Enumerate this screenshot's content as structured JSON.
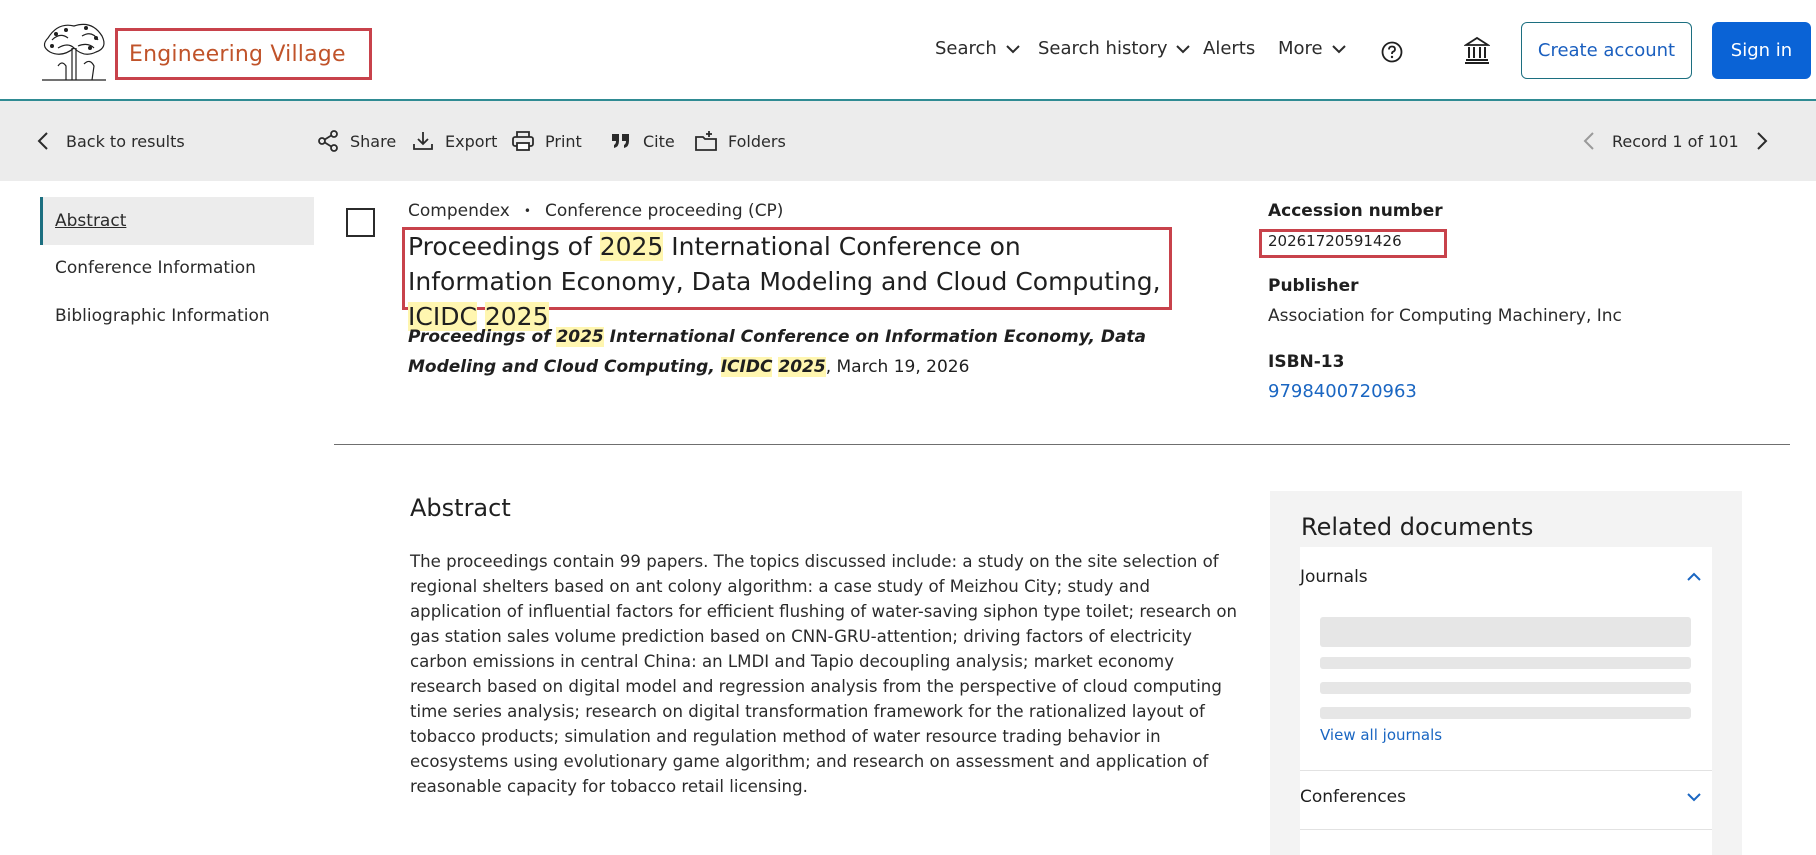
{
  "header": {
    "brand": "Engineering Village",
    "nav": {
      "search": "Search",
      "search_history": "Search history",
      "alerts": "Alerts",
      "more": "More"
    },
    "create_account": "Create account",
    "sign_in": "Sign in"
  },
  "toolbar": {
    "back": "Back to results",
    "share": "Share",
    "export": "Export",
    "print": "Print",
    "cite": "Cite",
    "folders": "Folders",
    "record": "Record 1 of 101"
  },
  "sidebar": {
    "items": [
      {
        "label": "Abstract",
        "active": true
      },
      {
        "label": "Conference Information",
        "active": false
      },
      {
        "label": "Bibliographic Information",
        "active": false
      }
    ]
  },
  "record": {
    "database": "Compendex",
    "separator": "•",
    "doc_type": "Conference proceeding (CP)",
    "title": {
      "p1": "Proceedings of ",
      "hl1": "2025",
      "p2": " International Conference on Information Economy, Data Modeling and Cloud Computing, ",
      "hl2": "ICIDC",
      "p3": " ",
      "hl3": "2025"
    },
    "source": {
      "s1": "Proceedings of ",
      "hl1": "2025",
      "s2": " International Conference on Information Economy, Data Modeling and Cloud Computing, ",
      "hl2": "ICIDC",
      "s3": " ",
      "hl3": "2025",
      "date": ", March 19, 2026"
    }
  },
  "details": {
    "accession_label": "Accession number",
    "accession_value": "20261720591426",
    "publisher_label": "Publisher",
    "publisher_value": "Association for Computing Machinery, Inc",
    "isbn_label": "ISBN-13",
    "isbn_value": "9798400720963"
  },
  "abstract": {
    "heading": "Abstract",
    "body": "The proceedings contain 99 papers. The topics discussed include: a study on the site selection of regional shelters based on ant colony algorithm: a case study of Meizhou City; study and application of influential factors for efficient flushing of water-saving siphon type toilet; research on gas station sales volume prediction based on CNN-GRU-attention; driving factors of electricity carbon emissions in central China: an LMDI and Tapio decoupling analysis; market economy research based on digital model and regression analysis from the perspective of cloud computing time series analysis; research on digital transformation framework for the rationalized layout of tobacco products; simulation and regulation method of water resource trading behavior in ecosystems using evolutionary game algorithm; and research on assessment and application of reasonable capacity for tobacco retail licensing."
  },
  "related": {
    "title": "Related documents",
    "journals": "Journals",
    "view_all": "View all journals",
    "conferences": "Conferences"
  },
  "colors": {
    "accent": "#0a63d6",
    "highlight": "#fff6b0",
    "annotation_box": "#c8424b",
    "toolbar_bg": "#ececec"
  }
}
